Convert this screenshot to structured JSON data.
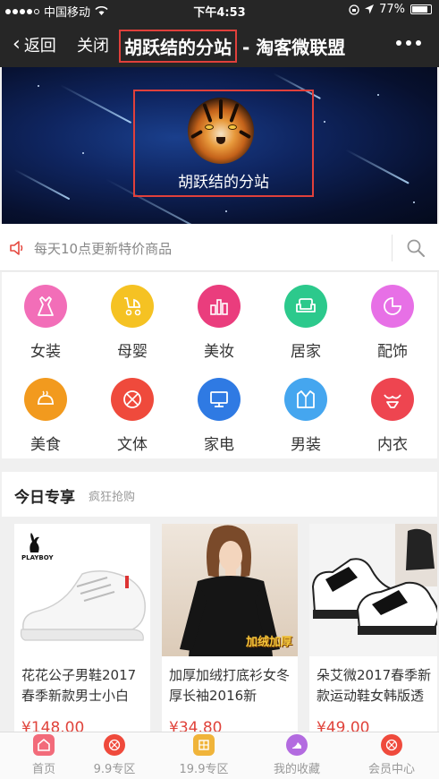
{
  "status_bar": {
    "carrier": "中国移动",
    "time": "下午4:53",
    "battery": "77%"
  },
  "nav": {
    "back_label": "返回",
    "close_label": "关闭",
    "title_highlight": "胡跃结的分站",
    "title_rest": "- 淘客微联盟"
  },
  "banner": {
    "name": "胡跃结的分站",
    "avatar_icon": "tiger-avatar"
  },
  "notice": {
    "text": "每天10点更新特价商品",
    "icon": "speaker-icon",
    "search_icon": "search-icon"
  },
  "categories": [
    {
      "label": "女装",
      "icon": "dress-icon",
      "color": "#f26eb8"
    },
    {
      "label": "母婴",
      "icon": "stroller-icon",
      "color": "#f5c223"
    },
    {
      "label": "美妆",
      "icon": "cosmetics-icon",
      "color": "#ea3d7d"
    },
    {
      "label": "居家",
      "icon": "sofa-icon",
      "color": "#2cc98c"
    },
    {
      "label": "配饰",
      "icon": "accessory-icon",
      "color": "#e770e6"
    },
    {
      "label": "美食",
      "icon": "food-icon",
      "color": "#f29a1e"
    },
    {
      "label": "文体",
      "icon": "basketball-icon",
      "color": "#ef4a3c"
    },
    {
      "label": "家电",
      "icon": "monitor-icon",
      "color": "#2f7ae3"
    },
    {
      "label": "男装",
      "icon": "suit-icon",
      "color": "#45a6ef"
    },
    {
      "label": "内衣",
      "icon": "bikini-icon",
      "color": "#ee4550"
    }
  ],
  "section": {
    "title": "今日专享",
    "subtitle": "疯狂抢购"
  },
  "products": [
    {
      "name": "花花公子男鞋2017春季新款男士小白",
      "price": "¥148.00",
      "brand": "PLAYBOY"
    },
    {
      "name": "加厚加绒打底衫女冬厚长袖2016新",
      "price": "¥34.80",
      "tag": "加绒加厚"
    },
    {
      "name": "朵艾微2017春季新款运动鞋女韩版透",
      "price": "¥49.00"
    }
  ],
  "tabs": [
    {
      "label": "首页",
      "icon": "home-icon",
      "color": "#f26b7a"
    },
    {
      "label": "9.9专区",
      "icon": "basketball-icon",
      "color": "#ef4a3c"
    },
    {
      "label": "19.9专区",
      "icon": "grid-icon",
      "color": "#f0b43a"
    },
    {
      "label": "我的收藏",
      "icon": "heel-icon",
      "color": "#b36be0"
    },
    {
      "label": "会员中心",
      "icon": "basketball-icon",
      "color": "#ef4a3c"
    }
  ],
  "colors": {
    "accent": "#e0403b",
    "price": "#e0443c",
    "nav_bg": "#262626"
  }
}
